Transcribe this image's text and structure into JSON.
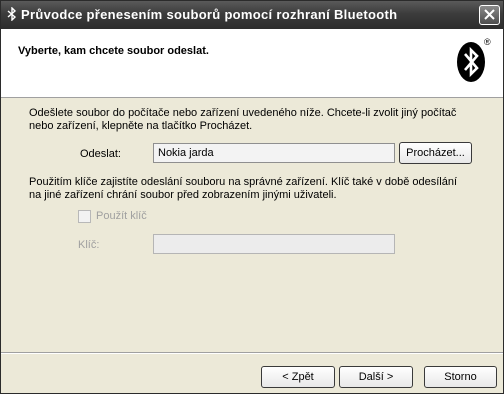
{
  "window": {
    "title": "Průvodce přenesením souborů pomocí rozhraní Bluetooth",
    "title_icon": "bluetooth-icon",
    "close_icon": "close-icon"
  },
  "header": {
    "heading": "Vyberte, kam chcete soubor odeslat.",
    "logo": "bluetooth-logo",
    "logo_mark": "®"
  },
  "content": {
    "intro_line1": "Odešlete soubor do počítače nebo zařízení uvedeného níže. Chcete-li zvolit jiný počítač",
    "intro_line2": "nebo zařízení, klepněte na tlačítko Procházet.",
    "send_label": "Odeslat:",
    "send_value": "Nokia jarda",
    "browse_label": "Procházet...",
    "key_line1": "Použitím klíče zajistíte odeslání souboru na správné zařízení. Klíč také v době odesílání",
    "key_line2": "na jiné zařízení chrání soubor před zobrazením jinými uživateli.",
    "use_key_label": "Použít klíč",
    "use_key_checked": false,
    "key_label": "Klíč:",
    "key_value": ""
  },
  "footer": {
    "back_label": "< Zpět",
    "next_label": "Další >",
    "cancel_label": "Storno"
  }
}
